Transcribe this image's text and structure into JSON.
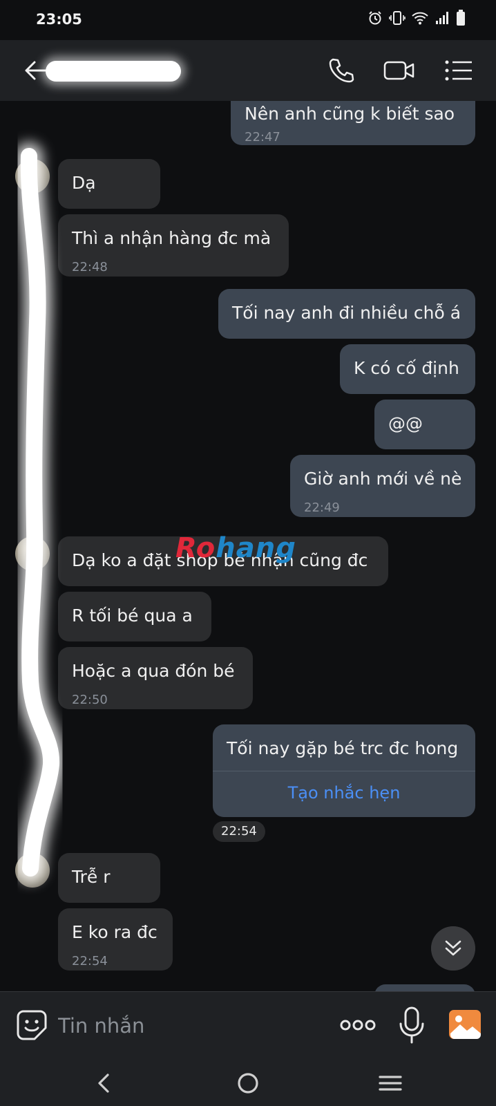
{
  "status_bar": {
    "time": "23:05"
  },
  "header": {
    "contact_name": ""
  },
  "messages": [
    {
      "text": "Nên anh cũng k biết sao",
      "time": "22:47"
    },
    {
      "text": "Dạ"
    },
    {
      "text": "Thì a nhận hàng đc mà",
      "time": "22:48"
    },
    {
      "text": "Tối nay anh đi nhiều chỗ á"
    },
    {
      "text": "K có cố định"
    },
    {
      "text": "@@"
    },
    {
      "text": "Giờ anh mới về nè",
      "time": "22:49"
    },
    {
      "text": "Dạ ko a đặt shop bé nhận cũng đc"
    },
    {
      "text": "R tối bé qua a"
    },
    {
      "text": "Hoặc a qua đón bé",
      "time": "22:50"
    },
    {
      "text": "Tối nay gặp bé trc đc hong",
      "action": "Tạo nhắc hẹn",
      "time": "22:54"
    },
    {
      "text": "Trễ r"
    },
    {
      "text": "E ko ra đc",
      "time": "22:54"
    }
  ],
  "watermark": {
    "part1": "Ro",
    "part2": "hang"
  },
  "input": {
    "placeholder": "Tin nhắn"
  },
  "colors": {
    "incoming_bubble": "#2b2c2e",
    "outgoing_bubble": "#3d4652",
    "link": "#4b8ff5",
    "header": "#1f2124"
  }
}
